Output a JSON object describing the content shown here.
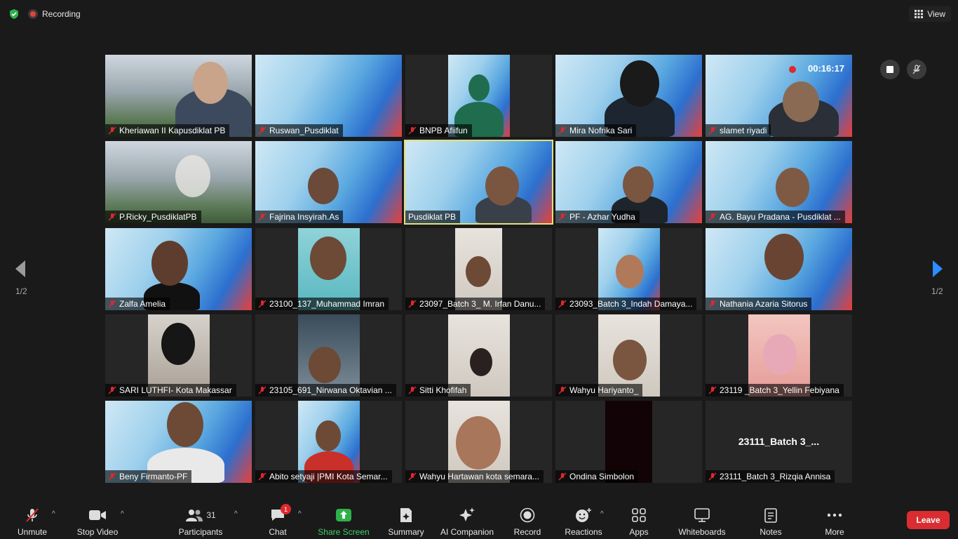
{
  "topbar": {
    "recording_label": "Recording",
    "view_label": "View"
  },
  "recording": {
    "timer": "00:16:17"
  },
  "pagination": {
    "left": "1/2",
    "right": "1/2"
  },
  "participants": [
    "Kheriawan II Kapusdiklat PB",
    "Ruswan_Pusdiklat",
    "BNPB Afiifun",
    "Mira Nofrika Sari",
    "slamet riyadi",
    "P.Ricky_PusdiklatPB",
    "Fajrina Insyirah.As",
    "Pusdiklat PB",
    "PF - Azhar Yudha",
    "AG. Bayu Pradana - Pusdiklat ...",
    "Zalfa Amelia",
    "23100_137_Muhammad Imran",
    "23097_Batch 3_ M. Irfan Danu...",
    "23093_Batch 3_Indah Damaya...",
    "Nathania Azaria Sitorus",
    "SARI LUTHFI-  Kota Makassar",
    "23105_691_Nirwana Oktavian ...",
    "Sitti Khofifah",
    "Wahyu Hariyanto_",
    "23119 _Batch 3_Yellin Febiyana",
    "Beny Firmanto-PF",
    "Abito setyaji |PMI Kota Semar...",
    "Wahyu Hartawan kota semara...",
    "Ondina Simbolon",
    "23111_Batch 3_Rizqia Annisa"
  ],
  "no_video_name": "23111_Batch 3_...",
  "toolbar": {
    "unmute": "Unmute",
    "stop_video": "Stop Video",
    "participants": "Participants",
    "participants_count": "31",
    "chat": "Chat",
    "chat_badge": "1",
    "share_screen": "Share Screen",
    "summary": "Summary",
    "ai_companion": "AI Companion",
    "record": "Record",
    "reactions": "Reactions",
    "apps": "Apps",
    "whiteboards": "Whiteboards",
    "notes": "Notes",
    "more": "More",
    "leave": "Leave"
  }
}
